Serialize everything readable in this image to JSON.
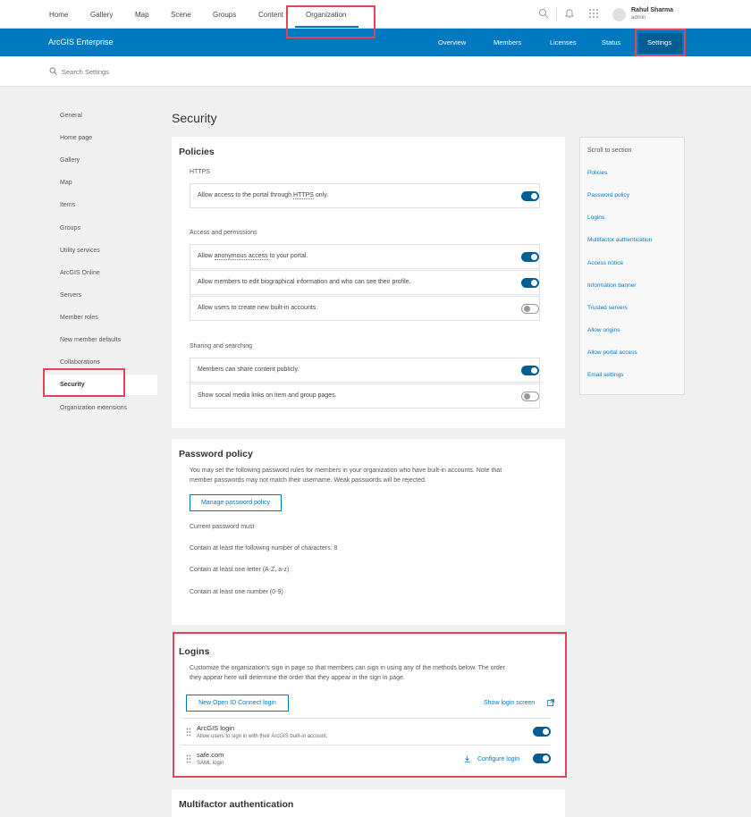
{
  "topnav": {
    "tabs": [
      "Home",
      "Gallery",
      "Map",
      "Scene",
      "Groups",
      "Content",
      "Organization"
    ],
    "user_name": "Rahul Sharma",
    "user_role": "admin",
    "search_icon": "magnifier-icon",
    "notification_icon": "bell-icon",
    "apps_icon": "grid-icon"
  },
  "bluebar": {
    "brand": "ArcGIS Enterprise",
    "nav": [
      "Overview",
      "Members",
      "Licenses",
      "Status",
      "Settings"
    ]
  },
  "search": {
    "placeholder": "Search Settings"
  },
  "sidebar": {
    "items": [
      "General",
      "Home page",
      "Gallery",
      "Map",
      "Items",
      "Groups",
      "Utility services",
      "ArcGIS Online",
      "Servers",
      "Member roles",
      "New member defaults",
      "Collaborations",
      "Security",
      "Organization extensions"
    ],
    "active": "Security"
  },
  "page_title": "Security",
  "policies": {
    "title": "Policies",
    "https_label": "HTTPS",
    "https_row": {
      "pre": "Allow access to the portal through ",
      "link": "HTTPS",
      "post": " only.",
      "on": true
    },
    "access_label": "Access and permissions",
    "access_rows": [
      {
        "pre": "Allow ",
        "link": "anonymous access",
        "post": " to your portal.",
        "on": true
      },
      {
        "pre": "Allow members to edit biographical information and who can see their profile.",
        "link": "",
        "post": "",
        "on": true
      },
      {
        "pre": "Allow users to create new built-in accounts.",
        "link": "",
        "post": "",
        "on": false
      }
    ],
    "sharing_label": "Sharing and searching",
    "sharing_rows": [
      {
        "text": "Members can share content publicly.",
        "on": true
      },
      {
        "text": "Show social media links on item and group pages.",
        "on": false
      }
    ]
  },
  "password": {
    "title": "Password policy",
    "desc1": "You may set the following password rules for members in your organization who have built-in accounts. Note that",
    "desc2": "member passwords may not match their username. Weak passwords will be rejected.",
    "button": "Manage password policy",
    "current": "Current password must",
    "rules": [
      "Contain at least the following number of characters: 8",
      "Contain at least one letter (A-Z, a-z)",
      "Contain at least one number (0-9)"
    ]
  },
  "logins": {
    "title": "Logins",
    "desc1": "Customize the organization's sign in page so that members can sign in using any of the methods below. The order",
    "desc2": "they appear here will determine the order that they appear in the sign in page.",
    "new_button": "New Open ID Connect login",
    "show_login": "Show login screen",
    "rows": [
      {
        "title": "ArcGIS login",
        "subtitle": "Allow users to sign in with their ArcGIS built-in account.",
        "on": true
      },
      {
        "title": "safe.com",
        "subtitle": "SAML login",
        "configure": "Configure login",
        "on": true
      }
    ]
  },
  "mfa": {
    "title": "Multifactor authentication"
  },
  "scroll_panel": {
    "heading": "Scroll to section",
    "items": [
      "Policies",
      "Password policy",
      "Logins",
      "Multifactor authentication",
      "Access notice",
      "Information banner",
      "Trusted servers",
      "Allow origins",
      "Allow portal access",
      "Email settings"
    ]
  },
  "colors": {
    "brand_blue": "#0079c1",
    "dark_blue": "#005e95",
    "highlight_red": "#e2445c"
  }
}
